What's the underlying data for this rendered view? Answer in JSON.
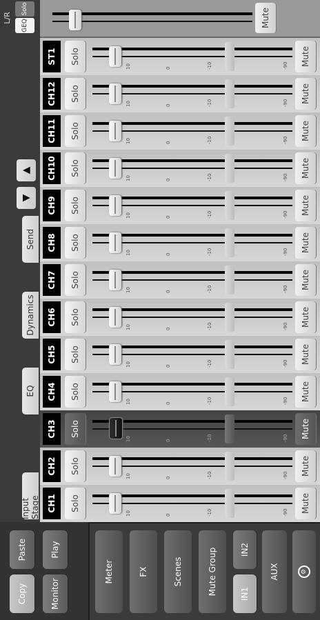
{
  "left": {
    "copy": "Copy",
    "paste": "Paste",
    "monitor": "Monitor",
    "play": "Play",
    "nav": [
      "Meter",
      "FX",
      "Scenes",
      "Mute Group"
    ],
    "in1": "IN1",
    "in2": "IN2",
    "aux": "AUX",
    "settings_icon": "gear-icon"
  },
  "tabs": [
    "Input Stage",
    "EQ",
    "Dynamics",
    "Send"
  ],
  "arrows": {
    "down": "▼",
    "up": "▲"
  },
  "channels": [
    {
      "label": "CH1",
      "solo": "Solo",
      "mute": "Mute"
    },
    {
      "label": "CH2",
      "solo": "Solo",
      "mute": "Mute"
    },
    {
      "label": "CH3",
      "solo": "Solo",
      "mute": "Mute",
      "selected": true
    },
    {
      "label": "CH4",
      "solo": "Solo",
      "mute": "Mute"
    },
    {
      "label": "CH5",
      "solo": "Solo",
      "mute": "Mute"
    },
    {
      "label": "CH6",
      "solo": "Solo",
      "mute": "Mute"
    },
    {
      "label": "CH7",
      "solo": "Solo",
      "mute": "Mute"
    },
    {
      "label": "CH8",
      "solo": "Solo",
      "mute": "Mute"
    },
    {
      "label": "CH9",
      "solo": "Solo",
      "mute": "Mute"
    },
    {
      "label": "CH10",
      "solo": "Solo",
      "mute": "Mute"
    },
    {
      "label": "CH11",
      "solo": "Solo",
      "mute": "Mute"
    },
    {
      "label": "CH12",
      "solo": "Solo",
      "mute": "Mute"
    },
    {
      "label": "ST1",
      "solo": "Solo",
      "mute": "Mute"
    }
  ],
  "scale": {
    "t10": "10",
    "t0": "0",
    "tm10": "-10",
    "low": "-90"
  },
  "lr": {
    "label": "L/R",
    "geq": "GEQ",
    "solo": "Solo",
    "mute": "Mute"
  }
}
